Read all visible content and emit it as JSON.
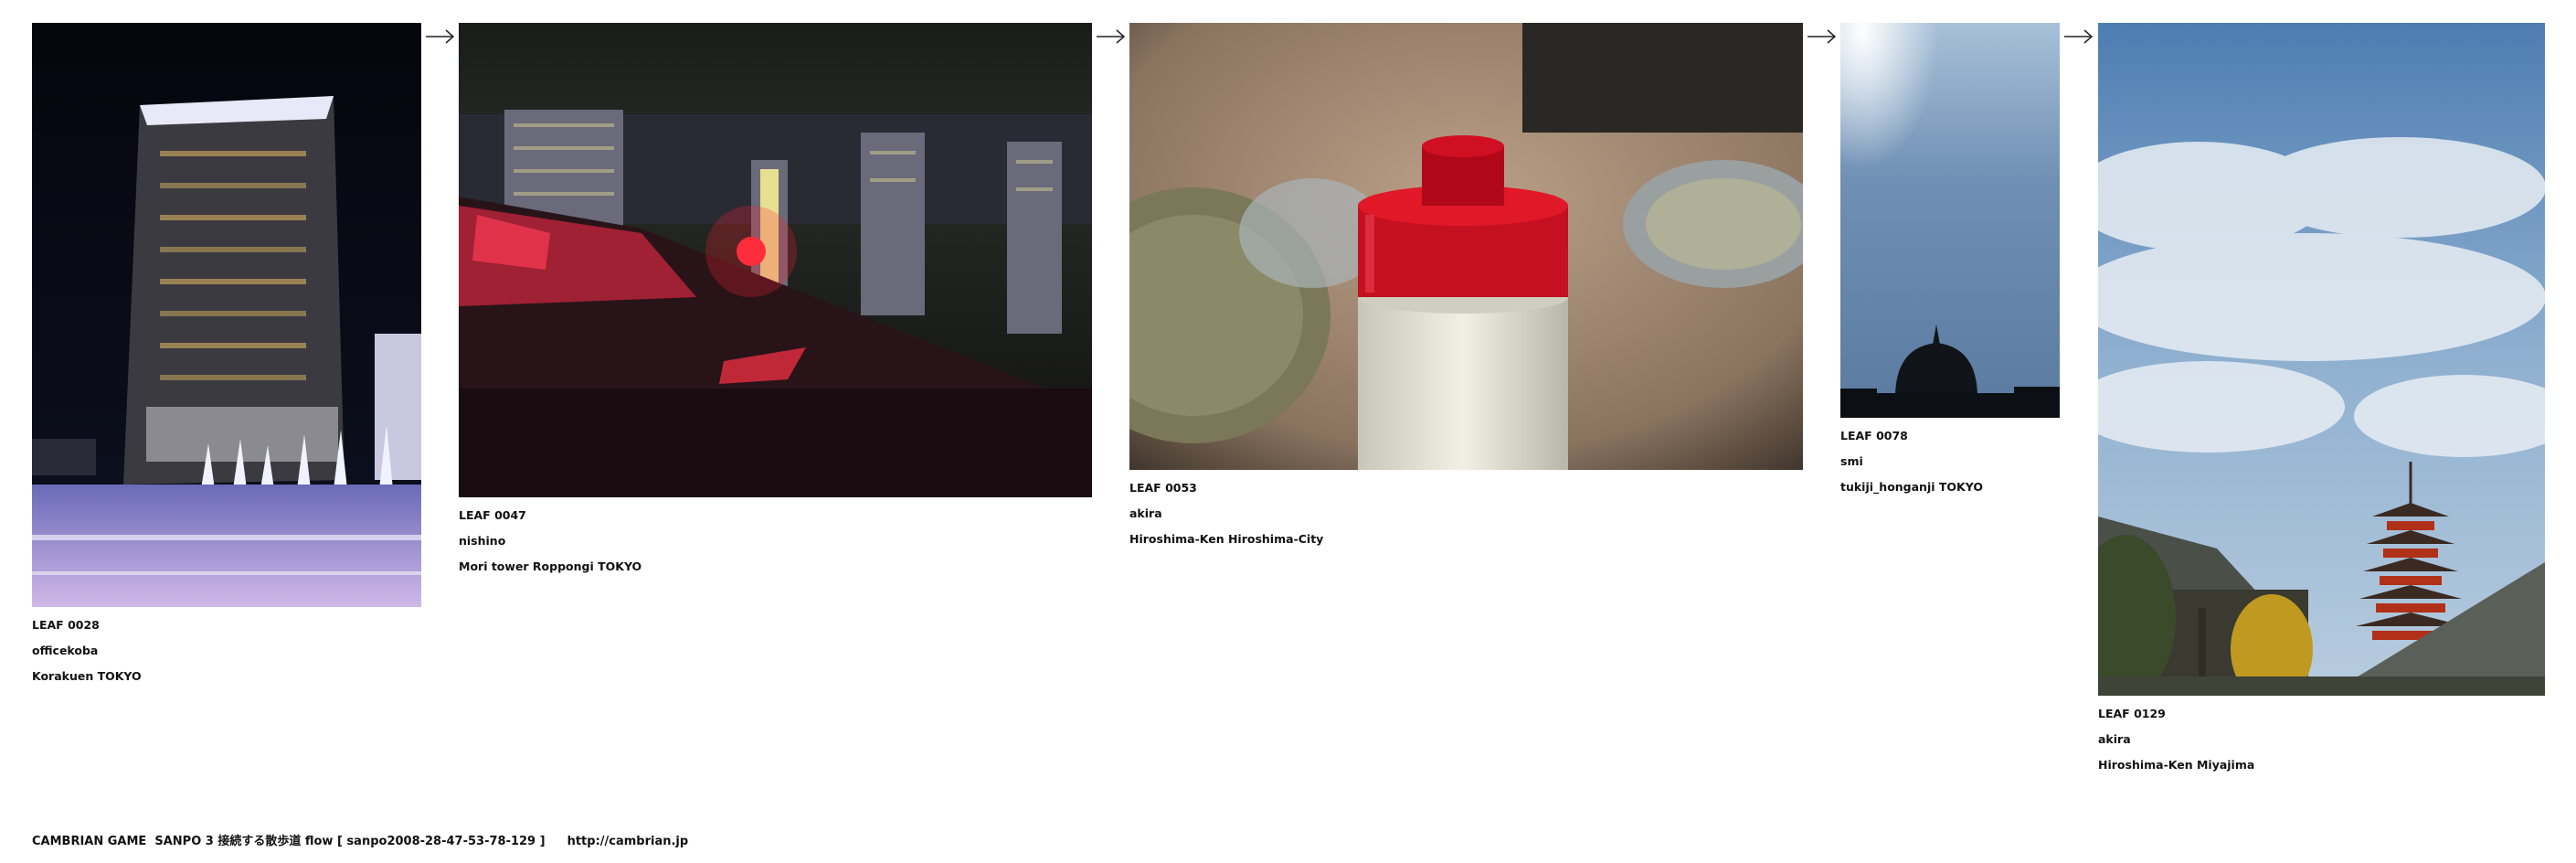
{
  "leaves": [
    {
      "leaf": "LEAF 0028",
      "author": "officekoba",
      "place": "Korakuen TOKYO"
    },
    {
      "leaf": "LEAF 0047",
      "author": "nishino",
      "place": "Mori tower Roppongi TOKYO"
    },
    {
      "leaf": "LEAF 0053",
      "author": "akira",
      "place": "Hiroshima-Ken Hiroshima-City"
    },
    {
      "leaf": "LEAF 0078",
      "author": "smi",
      "place": "tukiji_honganji TOKYO"
    },
    {
      "leaf": "LEAF 0129",
      "author": "akira",
      "place": "Hiroshima-Ken Miyajima"
    }
  ],
  "footer": {
    "text": "CAMBRIAN GAME  SANPO 3 接続する散歩道 flow [ sanpo2008-28-47-53-78-129 ]",
    "url": "http://cambrian.jp"
  },
  "colors": {
    "background": "#ffffff",
    "text": "#111111"
  },
  "icons": [
    "arrow-right-icon"
  ]
}
